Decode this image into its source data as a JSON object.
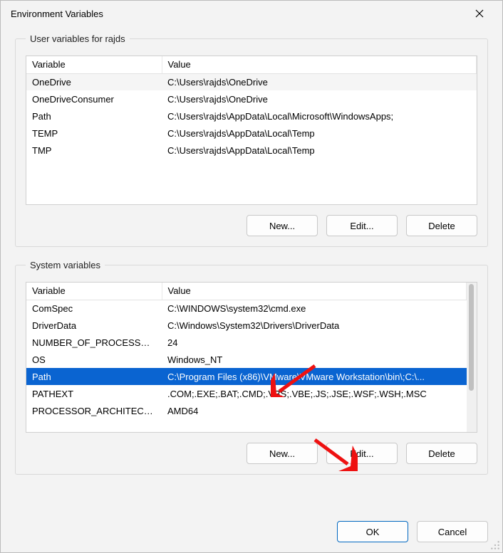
{
  "title": "Environment Variables",
  "user_group": {
    "legend": "User variables for rajds",
    "columns": [
      "Variable",
      "Value"
    ],
    "rows": [
      {
        "name": "OneDrive",
        "value": "C:\\Users\\rajds\\OneDrive"
      },
      {
        "name": "OneDriveConsumer",
        "value": "C:\\Users\\rajds\\OneDrive"
      },
      {
        "name": "Path",
        "value": "C:\\Users\\rajds\\AppData\\Local\\Microsoft\\WindowsApps;"
      },
      {
        "name": "TEMP",
        "value": "C:\\Users\\rajds\\AppData\\Local\\Temp"
      },
      {
        "name": "TMP",
        "value": "C:\\Users\\rajds\\AppData\\Local\\Temp"
      }
    ],
    "buttons": {
      "new": "New...",
      "edit": "Edit...",
      "delete": "Delete"
    }
  },
  "system_group": {
    "legend": "System variables",
    "columns": [
      "Variable",
      "Value"
    ],
    "rows": [
      {
        "name": "ComSpec",
        "value": "C:\\WINDOWS\\system32\\cmd.exe"
      },
      {
        "name": "DriverData",
        "value": "C:\\Windows\\System32\\Drivers\\DriverData"
      },
      {
        "name": "NUMBER_OF_PROCESSORS",
        "value": "24"
      },
      {
        "name": "OS",
        "value": "Windows_NT"
      },
      {
        "name": "Path",
        "value": "C:\\Program Files (x86)\\VMware\\VMware Workstation\\bin\\;C:\\..."
      },
      {
        "name": "PATHEXT",
        "value": ".COM;.EXE;.BAT;.CMD;.VBS;.VBE;.JS;.JSE;.WSF;.WSH;.MSC"
      },
      {
        "name": "PROCESSOR_ARCHITECTU...",
        "value": "AMD64"
      }
    ],
    "selected_index": 4,
    "buttons": {
      "new": "New...",
      "edit": "Edit...",
      "delete": "Delete"
    }
  },
  "footer": {
    "ok": "OK",
    "cancel": "Cancel"
  }
}
